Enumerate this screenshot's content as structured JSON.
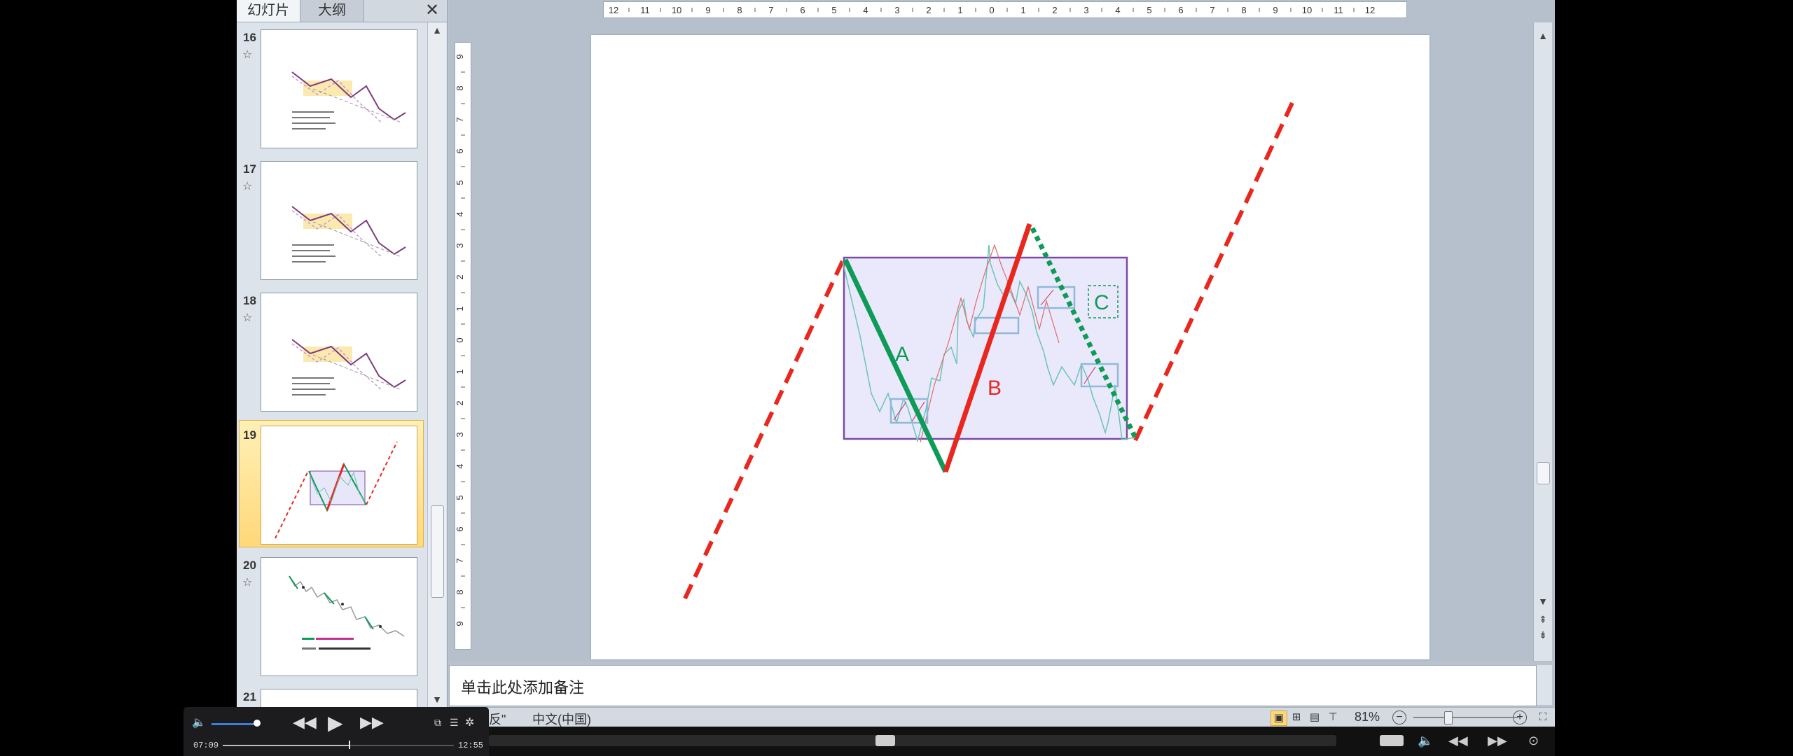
{
  "panel": {
    "tabs": [
      "幻灯片",
      "大纲"
    ],
    "close": "✕",
    "slides": [
      {
        "num": "16",
        "star": "☆"
      },
      {
        "num": "17",
        "star": "☆"
      },
      {
        "num": "18",
        "star": "☆"
      },
      {
        "num": "19",
        "star": ""
      },
      {
        "num": "20",
        "star": "☆"
      },
      {
        "num": "21",
        "star": ""
      }
    ]
  },
  "slide": {
    "label_a": "A",
    "label_b": "B",
    "label_c": "C",
    "colors": {
      "red": "#e8271f",
      "green": "#0e9a57",
      "box_fill": "#eae9fb",
      "box_stroke": "#7b4aa3",
      "teal": "#6cc3b7"
    }
  },
  "rulers": {
    "h_ticks": [
      "12",
      "11",
      "10",
      "9",
      "8",
      "7",
      "6",
      "5",
      "4",
      "3",
      "2",
      "1",
      "0",
      "1",
      "2",
      "3",
      "4",
      "5",
      "6",
      "7",
      "8",
      "9",
      "10",
      "11",
      "12"
    ],
    "v_ticks": [
      "9",
      "8",
      "7",
      "6",
      "5",
      "4",
      "3",
      "2",
      "1",
      "0",
      "1",
      "2",
      "3",
      "4",
      "5",
      "6",
      "7",
      "8",
      "9"
    ]
  },
  "notes": {
    "placeholder": "单击此处添加备注"
  },
  "status": {
    "theme_suffix": "反\"",
    "language": "中文(中国)",
    "zoom": "81%",
    "zoom_out": "−",
    "zoom_in": "+"
  },
  "player": {
    "current_time": "07:09",
    "total_time": "12:55"
  }
}
